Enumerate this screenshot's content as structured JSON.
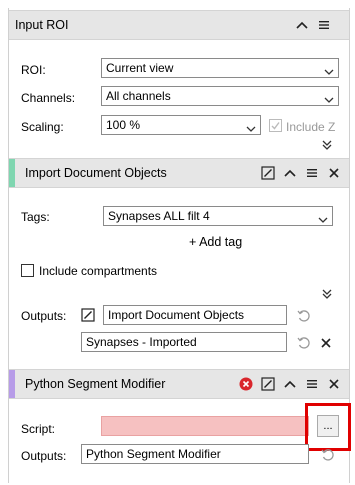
{
  "input_roi": {
    "title": "Input ROI",
    "roi_label": "ROI:",
    "roi_value": "Current view",
    "channels_label": "Channels:",
    "channels_value": "All channels",
    "scaling_label": "Scaling:",
    "scaling_value": "100 %",
    "include_z_label": "Include Z"
  },
  "import_doc": {
    "title": "Import Document Objects",
    "accent_color": "#7fd6b0",
    "tags_label": "Tags:",
    "tags_value": "Synapses ALL filt 4",
    "add_tag_label": "+ Add tag",
    "include_compartments_label": "Include compartments",
    "outputs_label": "Outputs:",
    "output1_value": "Import Document Objects",
    "output2_value": "Synapses - Imported"
  },
  "python_seg": {
    "title": "Python Segment Modifier",
    "accent_color": "#b79ce8",
    "script_label": "Script:",
    "script_value": "",
    "script_error_color": "#f6c1c1",
    "browse_label": "...",
    "outputs_label": "Outputs:",
    "output_value": "Python Segment Modifier"
  }
}
